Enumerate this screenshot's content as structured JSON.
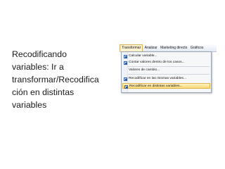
{
  "caption": {
    "lines": [
      "Recodificando",
      "variables: Ir a",
      "transformar/Recodifica",
      "ción en distintas",
      "variables"
    ]
  },
  "menubar": {
    "items": [
      "Transformar",
      "Analizar",
      "Marketing directo",
      "Gráficos"
    ],
    "active_index": 0
  },
  "menu": {
    "items": [
      {
        "label": "Calcular variable...",
        "icon": "calculator-icon"
      },
      {
        "label": "Contar valores dentro de los casos...",
        "icon": "count-values-icon"
      },
      {
        "label": "Valores de cambio...",
        "icon": ""
      },
      {
        "label": "Recodificar en las mismas variables...",
        "icon": "recode-icon"
      },
      {
        "label": "Recodificar en distintas variables...",
        "icon": "recode-icon"
      }
    ],
    "highlighted_index": 4
  },
  "colors": {
    "highlight": "#ffd978",
    "menubar": "#e4eaf3",
    "text": "#1a1a1a"
  }
}
